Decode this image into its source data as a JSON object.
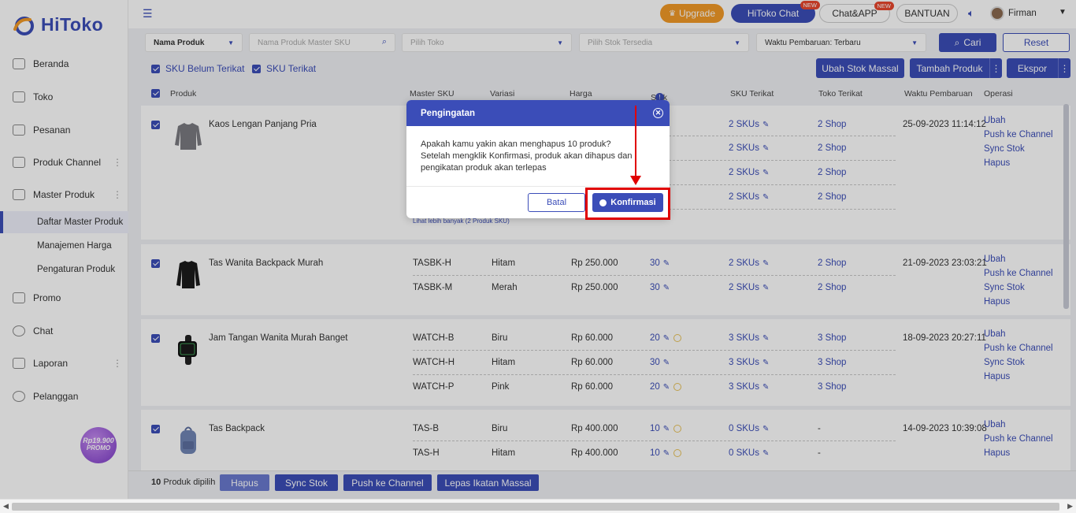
{
  "brand": {
    "name": "HiToko"
  },
  "sidebar": {
    "items": [
      {
        "label": "Beranda",
        "icon": "monitor-icon"
      },
      {
        "label": "Toko",
        "icon": "store-icon"
      },
      {
        "label": "Pesanan",
        "icon": "clipboard-icon"
      },
      {
        "label": "Produk Channel",
        "icon": "grid-icon"
      },
      {
        "label": "Master Produk",
        "icon": "box-icon"
      },
      {
        "label": "Promo",
        "icon": "ticket-icon"
      },
      {
        "label": "Chat",
        "icon": "chat-icon"
      },
      {
        "label": "Laporan",
        "icon": "report-icon"
      },
      {
        "label": "Pelanggan",
        "icon": "users-icon"
      }
    ],
    "sub_items": [
      {
        "label": "Daftar Master Produk",
        "active": true
      },
      {
        "label": "Manajemen Harga"
      },
      {
        "label": "Pengaturan Produk"
      }
    ],
    "promo_badge": {
      "line1": "Rp19.900",
      "line2": "PROMO"
    }
  },
  "topbar": {
    "upgrade": "Upgrade",
    "hitoko_chat": "HiToko Chat",
    "chat_app": "Chat&APP",
    "new_badge": "NEW",
    "bantuan": "BANTUAN",
    "username": "Firman"
  },
  "filters": {
    "field_select": "Nama Produk",
    "search_placeholder": "Nama Produk Master SKU",
    "toko_placeholder": "Pilih Toko",
    "stok_placeholder": "Pilih Stok Tersedia",
    "sort_select": "Waktu Pembaruan: Terbaru",
    "cari": "Cari",
    "reset": "Reset",
    "sku_unlinked": "SKU Belum Terikat",
    "sku_linked": "SKU Terikat",
    "ubah_stok": "Ubah Stok Massal",
    "tambah_produk": "Tambah Produk",
    "ekspor": "Ekspor"
  },
  "table": {
    "headers": {
      "produk": "Produk",
      "master_sku": "Master SKU",
      "variasi": "Variasi",
      "harga": "Harga",
      "stok": "Stok",
      "sku_terikat": "SKU Terikat",
      "toko_terikat": "Toko Terikat",
      "waktu": "Waktu Pembaruan",
      "operasi": "Operasi"
    },
    "ops": {
      "ubah": "Ubah",
      "push": "Push ke Channel",
      "sync": "Sync Stok",
      "hapus": "Hapus"
    },
    "products": [
      {
        "name": "Kaos Lengan Panjang Pria",
        "time": "25-09-2023 11:14:12",
        "lihat": "Lihat lebih banyak (2 Produk SKU)",
        "rows": [
          {
            "sku_linked": "2 SKUs",
            "shop": "2 Shop"
          },
          {
            "sku_linked": "2 SKUs",
            "shop": "2 Shop"
          },
          {
            "sku_linked": "2 SKUs",
            "shop": "2 Shop"
          },
          {
            "sku_linked": "2 SKUs",
            "shop": "2 Shop"
          }
        ]
      },
      {
        "name": "Tas Wanita Backpack Murah",
        "time": "21-09-2023 23:03:21",
        "rows": [
          {
            "sku": "TASBK-H",
            "variant": "Hitam",
            "price": "Rp 250.000",
            "stock": "30",
            "sku_linked": "2 SKUs",
            "shop": "2 Shop"
          },
          {
            "sku": "TASBK-M",
            "variant": "Merah",
            "price": "Rp 250.000",
            "stock": "30",
            "sku_linked": "2 SKUs",
            "shop": "2 Shop"
          }
        ]
      },
      {
        "name": "Jam Tangan Wanita Murah Banget",
        "time": "18-09-2023 20:27:11",
        "rows": [
          {
            "sku": "WATCH-B",
            "variant": "Biru",
            "price": "Rp 60.000",
            "stock": "20",
            "sku_linked": "3 SKUs",
            "shop": "3 Shop"
          },
          {
            "sku": "WATCH-H",
            "variant": "Hitam",
            "price": "Rp 60.000",
            "stock": "30",
            "sku_linked": "3 SKUs",
            "shop": "3 Shop"
          },
          {
            "sku": "WATCH-P",
            "variant": "Pink",
            "price": "Rp 60.000",
            "stock": "20",
            "sku_linked": "3 SKUs",
            "shop": "3 Shop"
          }
        ]
      },
      {
        "name": "Tas Backpack",
        "time": "14-09-2023 10:39:08",
        "rows": [
          {
            "sku": "TAS-B",
            "variant": "Biru",
            "price": "Rp 400.000",
            "stock": "10",
            "sku_linked": "0 SKUs",
            "shop": "-"
          },
          {
            "sku": "TAS-H",
            "variant": "Hitam",
            "price": "Rp 400.000",
            "stock": "10",
            "sku_linked": "0 SKUs",
            "shop": "-"
          }
        ]
      }
    ]
  },
  "bottombar": {
    "count": "10",
    "selected_text": "Produk dipilih",
    "hapus": "Hapus",
    "sync": "Sync Stok",
    "push": "Push ke Channel",
    "lepas": "Lepas Ikatan Massal"
  },
  "modal": {
    "title": "Pengingatan",
    "line1": "Apakah kamu yakin akan menghapus 10 produk?",
    "line2": "Setelah mengklik Konfirmasi, produk akan dihapus dan",
    "line3": "pengikatan produk akan terlepas",
    "batal": "Batal",
    "konfirmasi": "Konfirmasi"
  },
  "colors": {
    "primary": "#3b4db8",
    "upgrade": "#f29a28",
    "highlight": "#e00000"
  }
}
